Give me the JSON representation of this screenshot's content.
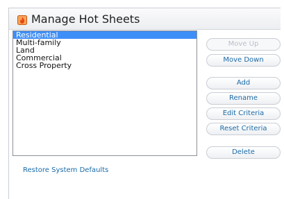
{
  "dialog": {
    "title": "Manage Hot Sheets",
    "icon": "hot-sheet-icon"
  },
  "list": {
    "items": [
      "Residential",
      "Multi-family",
      "Land",
      "Commercial",
      "Cross Property"
    ],
    "selected": "Residential"
  },
  "buttons": {
    "move_up": "Move Up",
    "move_down": "Move Down",
    "add": "Add",
    "rename": "Rename",
    "edit_criteria": "Edit Criteria",
    "reset_criteria": "Reset Criteria",
    "delete": "Delete"
  },
  "footer": {
    "restore_link": "Restore System Defaults"
  },
  "colors": {
    "selection": "#3e8ef7",
    "link": "#1a6aa8",
    "icon": "#f26b1d"
  }
}
